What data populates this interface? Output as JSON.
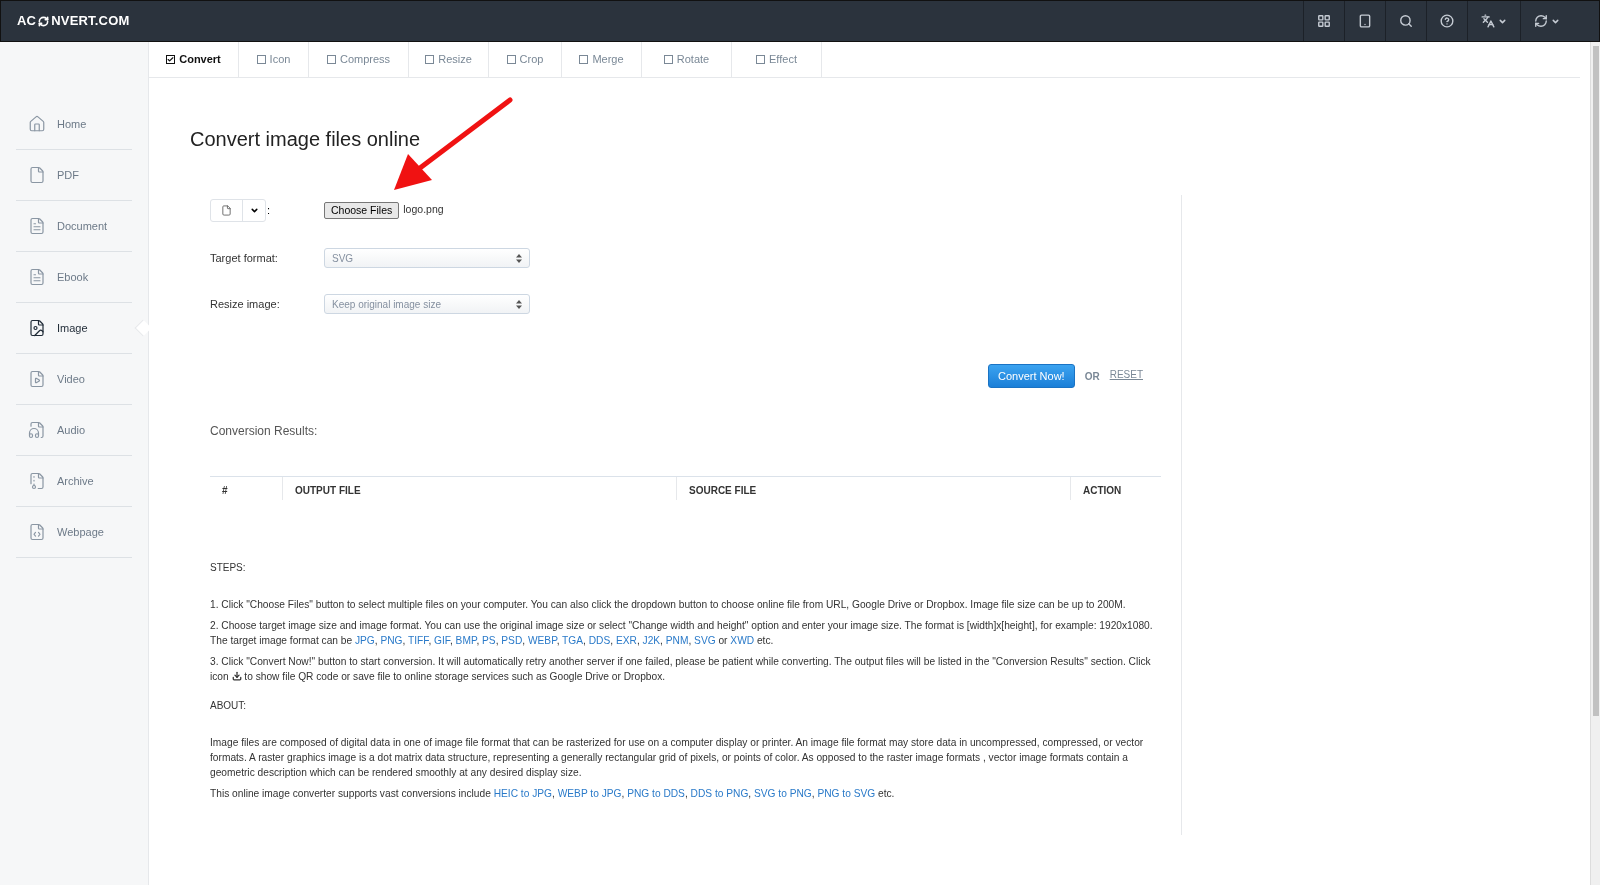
{
  "logo": {
    "before": "AC",
    "after": "NVERT.COM"
  },
  "tabs": [
    {
      "label": "Convert",
      "selected": true
    },
    {
      "label": "Icon",
      "selected": false
    },
    {
      "label": "Compress",
      "selected": false
    },
    {
      "label": "Resize",
      "selected": false
    },
    {
      "label": "Crop",
      "selected": false
    },
    {
      "label": "Merge",
      "selected": false
    },
    {
      "label": "Rotate",
      "selected": false
    },
    {
      "label": "Effect",
      "selected": false
    }
  ],
  "sidebar": {
    "items": [
      {
        "label": "Home",
        "selected": false
      },
      {
        "label": "PDF",
        "selected": false
      },
      {
        "label": "Document",
        "selected": false
      },
      {
        "label": "Ebook",
        "selected": false
      },
      {
        "label": "Image",
        "selected": true
      },
      {
        "label": "Video",
        "selected": false
      },
      {
        "label": "Audio",
        "selected": false
      },
      {
        "label": "Archive",
        "selected": false
      },
      {
        "label": "Webpage",
        "selected": false
      }
    ]
  },
  "title": "Convert image files online",
  "file_input": {
    "source_suffix": ":",
    "button": "Choose Files",
    "file_name": "logo.png"
  },
  "fields": [
    {
      "label": "Target format:",
      "value": "SVG"
    },
    {
      "label": "Resize image:",
      "value": "Keep original image size"
    }
  ],
  "convert_button": "Convert Now!",
  "or_text": "OR",
  "reset_link": "RESET",
  "results_heading": "Conversion Results:",
  "table": {
    "columns": [
      "#",
      "OUTPUT FILE",
      "SOURCE FILE",
      "ACTION"
    ]
  },
  "steps_heading": "STEPS:",
  "steps": [
    [
      {
        "kind": "text",
        "text": "1. Click \"Choose Files\" button to select multiple files on your computer. You can also click the dropdown button to choose online file from URL, Google Drive or Dropbox. Image file size can be up to 200M."
      }
    ],
    [
      {
        "kind": "text",
        "text": "2. Choose target image size and image format. You can use the original image size or select \"Change width and height\" option and enter your image size. The format is [width]x[height], for example: 1920x1080. The target image format can be "
      },
      {
        "kind": "link",
        "text": "JPG"
      },
      {
        "kind": "text",
        "text": ", "
      },
      {
        "kind": "link",
        "text": "PNG"
      },
      {
        "kind": "text",
        "text": ", "
      },
      {
        "kind": "link",
        "text": "TIFF"
      },
      {
        "kind": "text",
        "text": ", "
      },
      {
        "kind": "link",
        "text": "GIF"
      },
      {
        "kind": "text",
        "text": ", "
      },
      {
        "kind": "link",
        "text": "BMP"
      },
      {
        "kind": "text",
        "text": ", "
      },
      {
        "kind": "link",
        "text": "PS"
      },
      {
        "kind": "text",
        "text": ", "
      },
      {
        "kind": "link",
        "text": "PSD"
      },
      {
        "kind": "text",
        "text": ", "
      },
      {
        "kind": "link",
        "text": "WEBP"
      },
      {
        "kind": "text",
        "text": ", "
      },
      {
        "kind": "link",
        "text": "TGA"
      },
      {
        "kind": "text",
        "text": ", "
      },
      {
        "kind": "link",
        "text": "DDS"
      },
      {
        "kind": "text",
        "text": ", "
      },
      {
        "kind": "link",
        "text": "EXR"
      },
      {
        "kind": "text",
        "text": ", "
      },
      {
        "kind": "link",
        "text": "J2K"
      },
      {
        "kind": "text",
        "text": ", "
      },
      {
        "kind": "link",
        "text": "PNM"
      },
      {
        "kind": "text",
        "text": ", "
      },
      {
        "kind": "link",
        "text": "SVG"
      },
      {
        "kind": "text",
        "text": " or "
      },
      {
        "kind": "link",
        "text": "XWD"
      },
      {
        "kind": "text",
        "text": " etc."
      }
    ],
    [
      {
        "kind": "text",
        "text": "3. Click \"Convert Now!\" button to start conversion. It will automatically retry another server if one failed, please be patient while converting. The output files will be listed in the \"Conversion Results\" section. Click icon "
      },
      {
        "kind": "icon"
      },
      {
        "kind": "text",
        "text": " to show file QR code or save file to online storage services such as Google Drive or Dropbox."
      }
    ]
  ],
  "about_heading": "ABOUT:",
  "about": [
    [
      {
        "kind": "text",
        "text": "Image files are composed of digital data in one of image file format that can be rasterized for use on a computer display or printer. An image file format may store data in uncompressed, compressed, or vector formats. A raster graphics image is a dot matrix data structure, representing a generally rectangular grid of pixels, or points of color. As opposed to the raster image formats , vector image formats contain a geometric description which can be rendered smoothly at any desired display size."
      }
    ],
    [
      {
        "kind": "text",
        "text": "This online image converter supports vast conversions include "
      },
      {
        "kind": "link",
        "text": "HEIC to JPG"
      },
      {
        "kind": "text",
        "text": ", "
      },
      {
        "kind": "link",
        "text": "WEBP to JPG"
      },
      {
        "kind": "text",
        "text": ", "
      },
      {
        "kind": "link",
        "text": "PNG to DDS"
      },
      {
        "kind": "text",
        "text": ", "
      },
      {
        "kind": "link",
        "text": "DDS to PNG"
      },
      {
        "kind": "text",
        "text": ", "
      },
      {
        "kind": "link",
        "text": "SVG to PNG"
      },
      {
        "kind": "text",
        "text": ", "
      },
      {
        "kind": "link",
        "text": "PNG to SVG"
      },
      {
        "kind": "text",
        "text": " etc."
      }
    ]
  ]
}
